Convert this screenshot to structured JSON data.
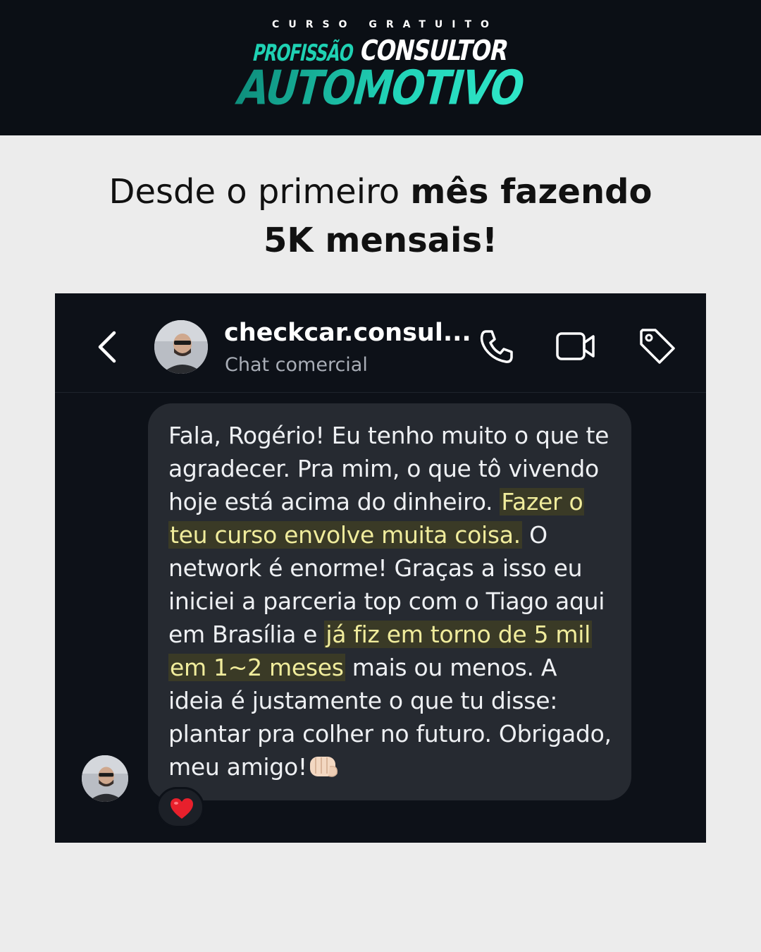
{
  "banner": {
    "kicker": "CURSO GRATUITO",
    "logo_line1a": "PROFISSÃO",
    "logo_line1b": "CONSULTOR",
    "logo_line2": "AUTOMOTIVO"
  },
  "headline": {
    "part1": "Desde o primeiro ",
    "part1_bold": "mês fazendo",
    "line2_bold": "5K mensais!"
  },
  "chat": {
    "back_icon": "chevron-left-icon",
    "contact_name": "checkcar.consul...",
    "contact_subtitle": "Chat comercial",
    "icons": [
      "phone-icon",
      "video-icon",
      "tag-icon"
    ],
    "message": {
      "t1": "Fala, Rogério! Eu tenho muito o que te agradecer. Pra mim, o que tô vivendo hoje está acima do dinheiro. ",
      "h1": "Fazer o teu curso envolve muita coisa.",
      "t2": " O network é enorme! Graças a isso eu iniciei a parceria top com o Tiago  aqui em Brasília e ",
      "h2": "já fiz em torno de 5 mil em 1~2 meses",
      "t3": " mais ou menos. A ideia é justamente o que tu disse: plantar pra colher no futuro. Obrigado, meu amigo!",
      "emoji": "fist-emoji-icon"
    },
    "reaction": "heart-icon",
    "colors": {
      "background": "#0d1118",
      "bubble": "#262a31",
      "highlight_text": "#f0ec9c",
      "highlight_bg": "#3a3a26"
    }
  },
  "colors": {
    "banner_bg": "#0b0f15",
    "page_bg": "#ececec",
    "logo_teal": "#21d4b8"
  }
}
